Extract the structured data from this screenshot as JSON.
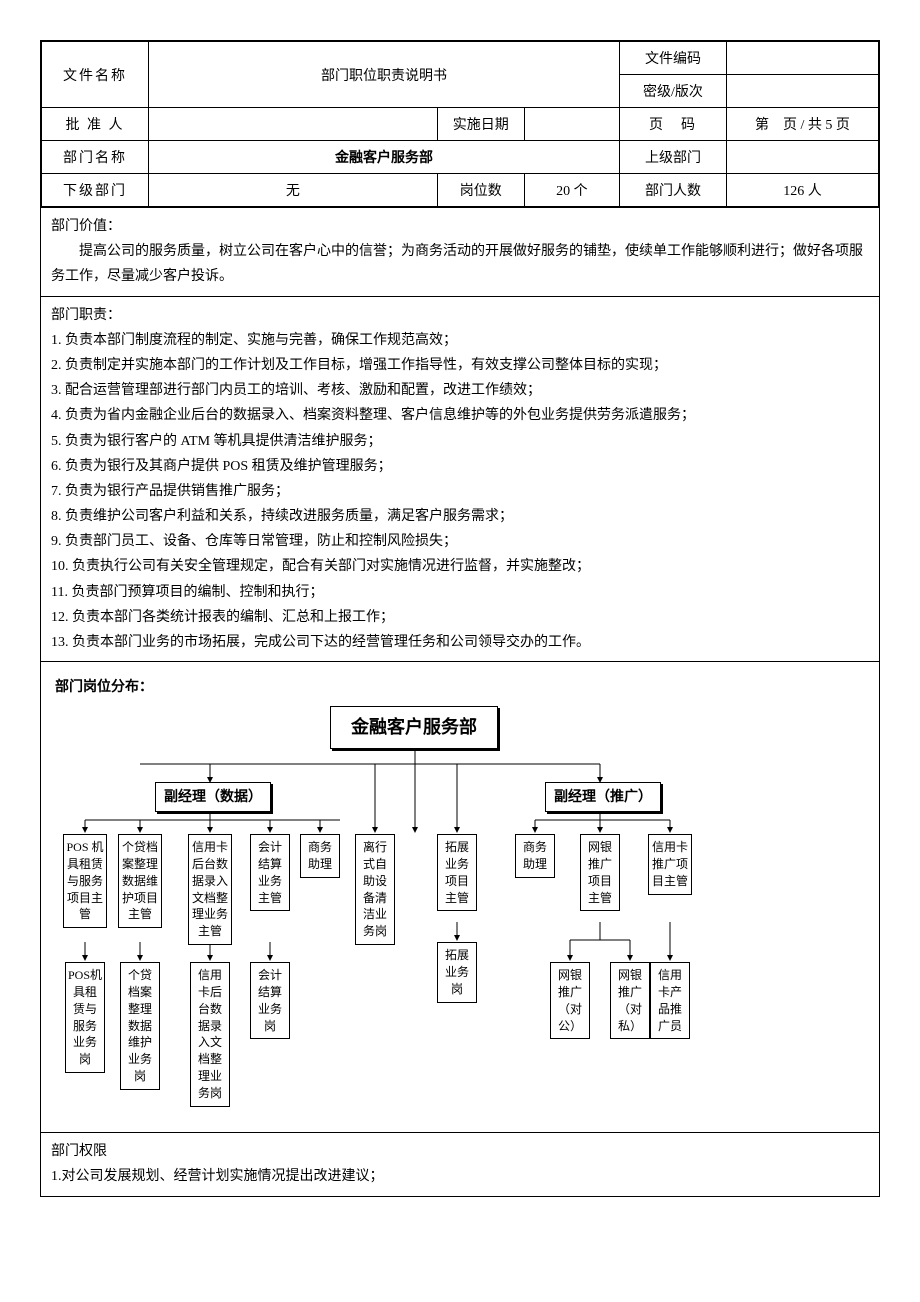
{
  "header": {
    "file_name_label": "文件名称",
    "file_name_value": "部门职位职责说明书",
    "file_code_label": "文件编码",
    "file_code_value": "",
    "secrecy_label": "密级/版次",
    "secrecy_value": "",
    "approver_label": "批 准 人",
    "approver_value": "",
    "impl_date_label": "实施日期",
    "impl_date_value": "",
    "page_label": "页　码",
    "page_value": "第　页 / 共 5 页",
    "dept_name_label": "部门名称",
    "dept_name_value": "金融客户服务部",
    "parent_dept_label": "上级部门",
    "parent_dept_value": "",
    "sub_dept_label": "下级部门",
    "sub_dept_value": "无",
    "positions_label": "岗位数",
    "positions_value": "20 个",
    "headcount_label": "部门人数",
    "headcount_value": "126 人"
  },
  "value_section": {
    "title": "部门价值：",
    "body": "提高公司的服务质量，树立公司在客户心中的信誉；为商务活动的开展做好服务的铺垫，使续单工作能够顺利进行；做好各项服务工作，尽量减少客户投诉。"
  },
  "duties": {
    "title": "部门职责：",
    "items": [
      "1. 负责本部门制度流程的制定、实施与完善，确保工作规范高效；",
      "2. 负责制定并实施本部门的工作计划及工作目标，增强工作指导性，有效支撑公司整体目标的实现；",
      "3. 配合运营管理部进行部门内员工的培训、考核、激励和配置，改进工作绩效；",
      "4. 负责为省内金融企业后台的数据录入、档案资料整理、客户信息维护等的外包业务提供劳务派遣服务；",
      "5. 负责为银行客户的 ATM 等机具提供清洁维护服务；",
      "6. 负责为银行及其商户提供 POS 租赁及维护管理服务；",
      "7. 负责为银行产品提供销售推广服务；",
      "8. 负责维护公司客户利益和关系，持续改进服务质量，满足客户服务需求；",
      "9. 负责部门员工、设备、仓库等日常管理，防止和控制风险损失；",
      "10. 负责执行公司有关安全管理规定，配合有关部门对实施情况进行监督，并实施整改；",
      "11. 负责部门预算项目的编制、控制和执行；",
      "12. 负责本部门各类统计报表的编制、汇总和上报工作；",
      "13. 负责本部门业务的市场拓展，完成公司下达的经营管理任务和公司领导交办的工作。"
    ]
  },
  "chart": {
    "title": "部门岗位分布：",
    "root": "金融客户服务部",
    "mgr_left": "副经理（数据）",
    "mgr_right": "副经理（推广）",
    "left_cols": [
      "POS 机具租赁与服务项目主管",
      "个贷档案整理数据维护项目主管",
      "信用卡后台数据录入文档整理业务主管",
      "会计结算业务主管",
      "商务助理",
      "离行式自助设备清洁业务岗"
    ],
    "left_subs": [
      "POS机具租赁与服务业务岗",
      "个贷档案整理数据维护业务岗",
      "信用卡后台数据录入文档整理业务岗",
      "会计结算业务岗"
    ],
    "mid_col": "拓展业务项目主管",
    "mid_sub": "拓展业务岗",
    "right_cols": [
      "商务助理",
      "网银推广项目主管",
      "信用卡推广项目主管"
    ],
    "right_subs": [
      "网银推广（对公）",
      "网银推广（对私）",
      "信用卡产品推广员"
    ]
  },
  "authority": {
    "title": "部门权限",
    "items": [
      "1.对公司发展规划、经营计划实施情况提出改进建议；"
    ]
  }
}
